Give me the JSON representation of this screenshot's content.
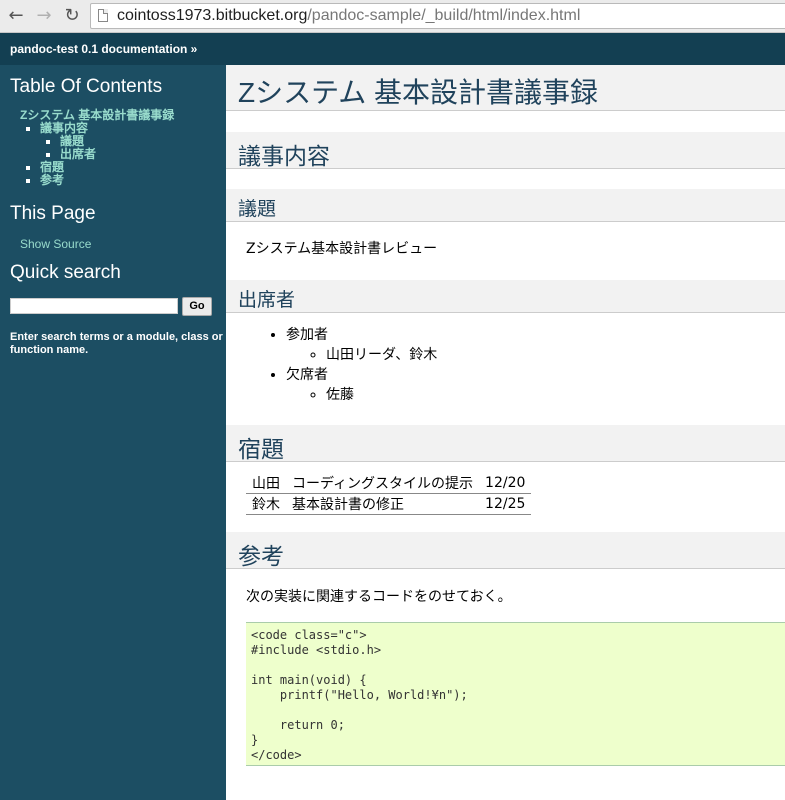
{
  "browser": {
    "back": "←",
    "forward": "→",
    "reload": "↻",
    "url_host": "cointoss1973.bitbucket.org",
    "url_path": "/pandoc-sample/_build/html/index.html"
  },
  "related": {
    "doc_link": "pandoc-test 0.1 documentation »"
  },
  "sidebar": {
    "toc_title": "Table Of Contents",
    "toc": {
      "root": "Zシステム 基本設計書議事録",
      "item1": "議事内容",
      "item1_sub1": "議題",
      "item1_sub2": "出席者",
      "item2": "宿題",
      "item3": "参考"
    },
    "this_page_title": "This Page",
    "show_source": "Show Source",
    "quick_search_title": "Quick search",
    "search_value": "",
    "go_label": "Go",
    "search_hint": "Enter search terms or a module, class or function name."
  },
  "document": {
    "title": "Zシステム 基本設計書議事録",
    "section_minutes": "議事内容",
    "section_agenda": "議題",
    "agenda_text": "Zシステム基本設計書レビュー",
    "section_attendees": "出席者",
    "attendees": {
      "present_label": "参加者",
      "present_names": "山田リーダ、鈴木",
      "absent_label": "欠席者",
      "absent_names": "佐藤"
    },
    "section_homework": "宿題",
    "homework": [
      {
        "who": "山田",
        "task": "コーディングスタイルの提示",
        "due": "12/20"
      },
      {
        "who": "鈴木",
        "task": "基本設計書の修正",
        "due": "12/25"
      }
    ],
    "section_reference": "参考",
    "reference_text": "次の実装に関連するコードをのせておく。",
    "code_lines": {
      "l1": "<code class=\"c\">",
      "l2": "#include <stdio.h>",
      "l3": "",
      "l4": "int main(void) {",
      "l5": "    printf(\"Hello, World!¥n\");",
      "l6": "",
      "l7": "    return 0;",
      "l8": "}",
      "l9": "</code>"
    }
  },
  "colors": {
    "related_bar": "#133f52",
    "sidebar": "#1c4e63",
    "sidebar_link": "#98dbcc",
    "heading_text": "#20435c",
    "heading_bg": "#f2f2f2",
    "code_bg": "#eeffcc"
  }
}
